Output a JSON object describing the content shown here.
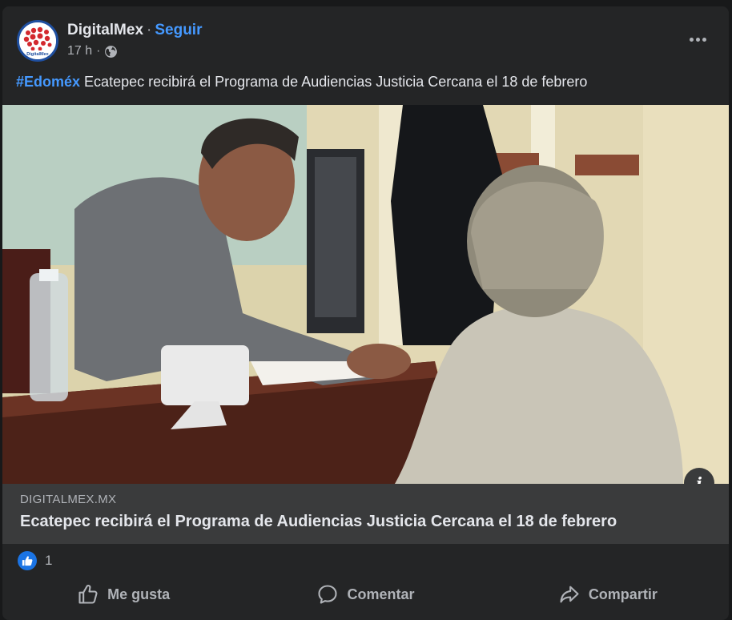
{
  "post": {
    "author": "DigitalMex",
    "separator": "·",
    "follow_label": "Seguir",
    "time": "17 h",
    "meta_separator": "·",
    "privacy_icon": "globe-icon",
    "caption_hashtag": "#Edoméx",
    "caption_text": " Ecatepec recibirá el Programa de Audiencias Justicia Cercana el 18 de febrero",
    "avatar_logo_text": "DigitalMex"
  },
  "link_preview": {
    "domain": "DIGITALMEX.MX",
    "title": "Ecatepec recibirá el Programa de Audiencias Justicia Cercana el 18 de febrero",
    "info_icon_label": "i"
  },
  "reactions": {
    "icon": "like-icon",
    "count": "1"
  },
  "actions": {
    "like_label": "Me gusta",
    "comment_label": "Comentar",
    "share_label": "Compartir"
  },
  "colors": {
    "background": "#242526",
    "link_blue": "#4599ff",
    "secondary_text": "#b0b3b8",
    "like_badge": "#1b74e4"
  }
}
